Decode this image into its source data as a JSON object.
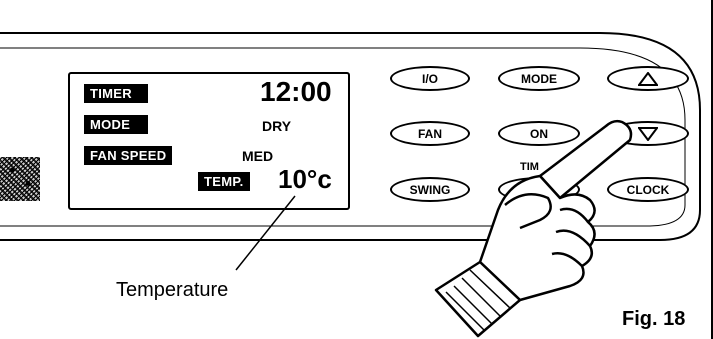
{
  "display": {
    "labels": {
      "timer": "TIMER",
      "mode": "MODE",
      "fan_speed": "FAN SPEED",
      "temp": "TEMP."
    },
    "values": {
      "clock": "12:00",
      "mode": "DRY",
      "fan_speed": "MED",
      "temperature": "10°c"
    }
  },
  "buttons": {
    "io": "I/O",
    "mode": "MODE",
    "up": "up-triangle-icon",
    "fan": "FAN",
    "on": "ON",
    "down": "down-triangle-icon",
    "timer_partial": "TIM",
    "swing": "SWING",
    "clock": "CLOCK"
  },
  "annotation": {
    "temperature_label": "Temperature"
  },
  "figure": {
    "label": "Fig. 18"
  }
}
